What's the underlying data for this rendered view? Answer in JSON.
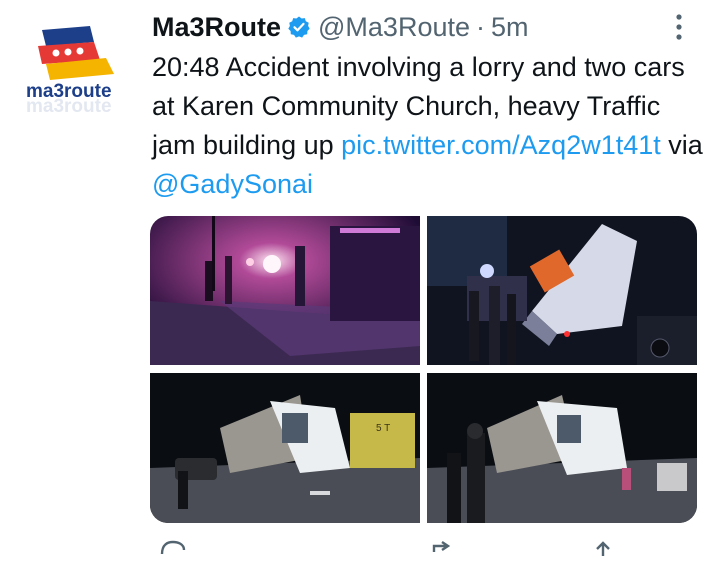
{
  "account": {
    "display_name": "Ma3Route",
    "handle": "@Ma3Route",
    "separator": "·",
    "time": "5m",
    "avatar_text": "ma3route",
    "avatar_reflection": "ma3route"
  },
  "tweet": {
    "text": "20:48 Accident involving a lorry and two cars at Karen Community Church, heavy Traffic jam building up ",
    "link": "pic.twitter.com/Azq2w1t41t",
    "via": " via ",
    "mention": "@GadySonai"
  },
  "icons": {
    "verified": "verified-badge-icon",
    "more": "more-vertical-icon",
    "reply": "reply-icon",
    "retweet": "retweet-icon",
    "share": "share-icon"
  },
  "colors": {
    "link": "#1d9bf0",
    "secondary_text": "#536471",
    "verified": "#1d9bf0"
  },
  "media": {
    "photos": [
      {
        "alt": "night-accident-scene-purple-light"
      },
      {
        "alt": "overturned-lorry-with-crowd"
      },
      {
        "alt": "overturned-lorry-roadside"
      },
      {
        "alt": "overturned-lorry-people-nearby"
      }
    ]
  }
}
